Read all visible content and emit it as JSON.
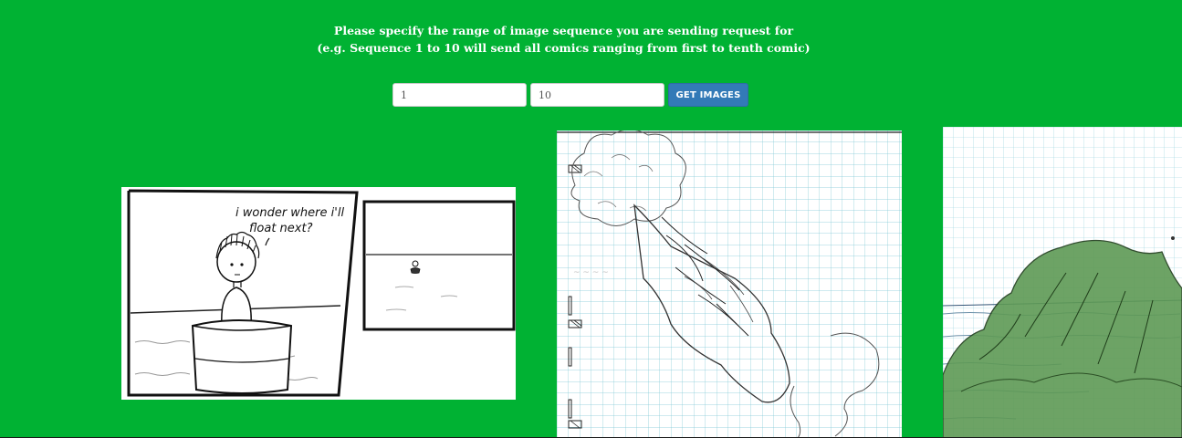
{
  "instructions": {
    "line1": "Please specify the range of image sequence you are sending request for",
    "line2": "(e.g. Sequence 1 to 10 will send all comics ranging from first to tenth comic)"
  },
  "form": {
    "start_value": "1",
    "end_value": "10",
    "submit_label": "GET IMAGES"
  },
  "comics": [
    {
      "speech": [
        "i wonder where i'll",
        "float next?"
      ]
    },
    {},
    {}
  ],
  "colors": {
    "background": "#00b233",
    "button": "#337ab7",
    "text": "#ffffff"
  }
}
